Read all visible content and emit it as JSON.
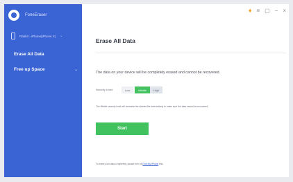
{
  "app": {
    "name": "FoneEraser"
  },
  "sidebar": {
    "device_label": "Rabbit - iPhone(iPhone X)",
    "items": [
      {
        "label": "Erase All Data"
      },
      {
        "label": "Free up Space"
      }
    ]
  },
  "window": {
    "icons": [
      "gem-icon",
      "menu-icon",
      "feedback-icon",
      "minimize-icon",
      "close-icon"
    ]
  },
  "main": {
    "title": "Erase All Data",
    "info": "The data on your device will be completely erased and cannot be recovered.",
    "security": {
      "label": "Security Level:",
      "levels": [
        "Low",
        "Middle",
        "High"
      ],
      "selected": "Middle"
    },
    "description": "The Middle security level will overwrite the deleted file data entirely to make sure the data cannot be recovered.",
    "start_label": "Start",
    "footer": {
      "text": "To erase your data completely, please turn off",
      "link": "Find My iPhone",
      "suffix": "first."
    }
  },
  "colors": {
    "sidebar": "#3a63d3",
    "accent_green": "#41c25f",
    "link": "#3a63d3"
  }
}
